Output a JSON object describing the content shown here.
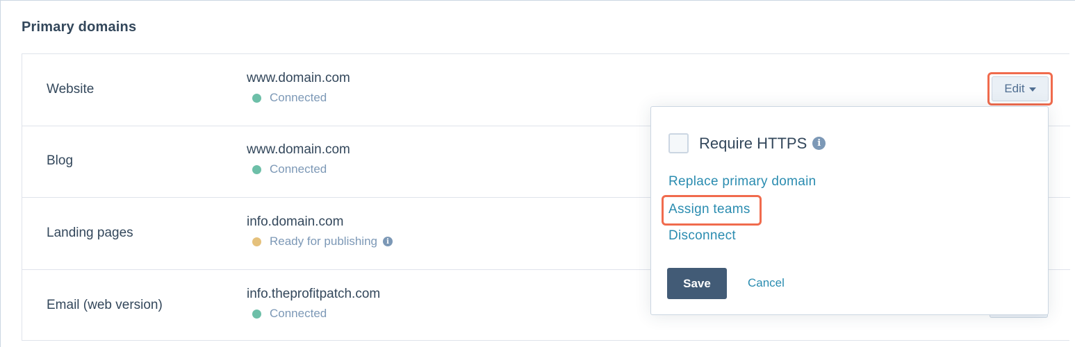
{
  "section": {
    "title": "Primary domains"
  },
  "rows": [
    {
      "label": "Website",
      "domain": "www.domain.com",
      "status": "Connected",
      "status_color": "#6dbfa8"
    },
    {
      "label": "Blog",
      "domain": "www.domain.com",
      "status": "Connected",
      "status_color": "#6dbfa8"
    },
    {
      "label": "Landing pages",
      "domain": "info.domain.com",
      "status": "Ready for publishing",
      "status_color": "#e5c17c"
    },
    {
      "label": "Email (web version)",
      "domain": "info.theprofitpatch.com",
      "status": "Connected",
      "status_color": "#6dbfa8"
    }
  ],
  "edit_button": {
    "label": "Edit"
  },
  "dropdown": {
    "require_https_label": "Require HTTPS",
    "require_https_checked": false,
    "links": {
      "replace": "Replace primary domain",
      "assign": "Assign teams",
      "disconnect": "Disconnect"
    },
    "save_label": "Save",
    "cancel_label": "Cancel"
  },
  "colors": {
    "highlight": "#f06b4d",
    "link": "#2a8cb0",
    "save_button": "#425b76"
  },
  "icons": {
    "info": "info-icon",
    "caret": "caret-down-icon"
  }
}
